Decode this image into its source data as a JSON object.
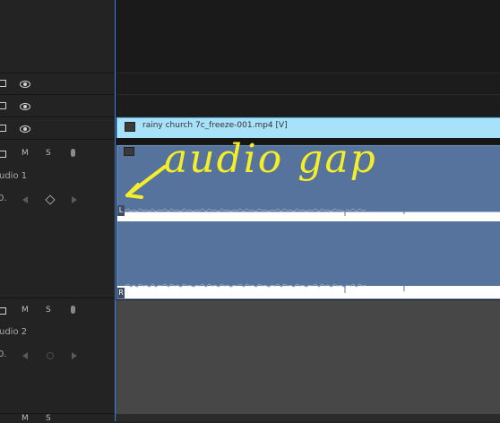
{
  "tracks": {
    "video": [
      {
        "id": "v3",
        "eye": "visible"
      },
      {
        "id": "v2",
        "eye": "visible"
      },
      {
        "id": "v1",
        "eye": "visible"
      }
    ],
    "audio": [
      {
        "id": "a1",
        "label": "udio 1",
        "mute": "M",
        "solo": "S",
        "vol_prefix": "0."
      },
      {
        "id": "a2",
        "label": "udio 2",
        "mute": "M",
        "solo": "S",
        "vol_prefix": "0."
      }
    ],
    "a3_partial": {
      "mute": "M",
      "solo": "S"
    }
  },
  "timeline": {
    "video_clip_name": "rainy church 7c_freeze-001.mp4 [V]",
    "audio_clip_channels": {
      "left": "L",
      "right": "R"
    }
  },
  "annotation": {
    "text": "audio gap",
    "arrow": "left-arrow",
    "color": "#f4ee2a"
  },
  "colors": {
    "video_clip": "#a8e1fa",
    "audio_clip": "#55739c",
    "playhead": "#3d7fe0",
    "background": "#232323"
  }
}
